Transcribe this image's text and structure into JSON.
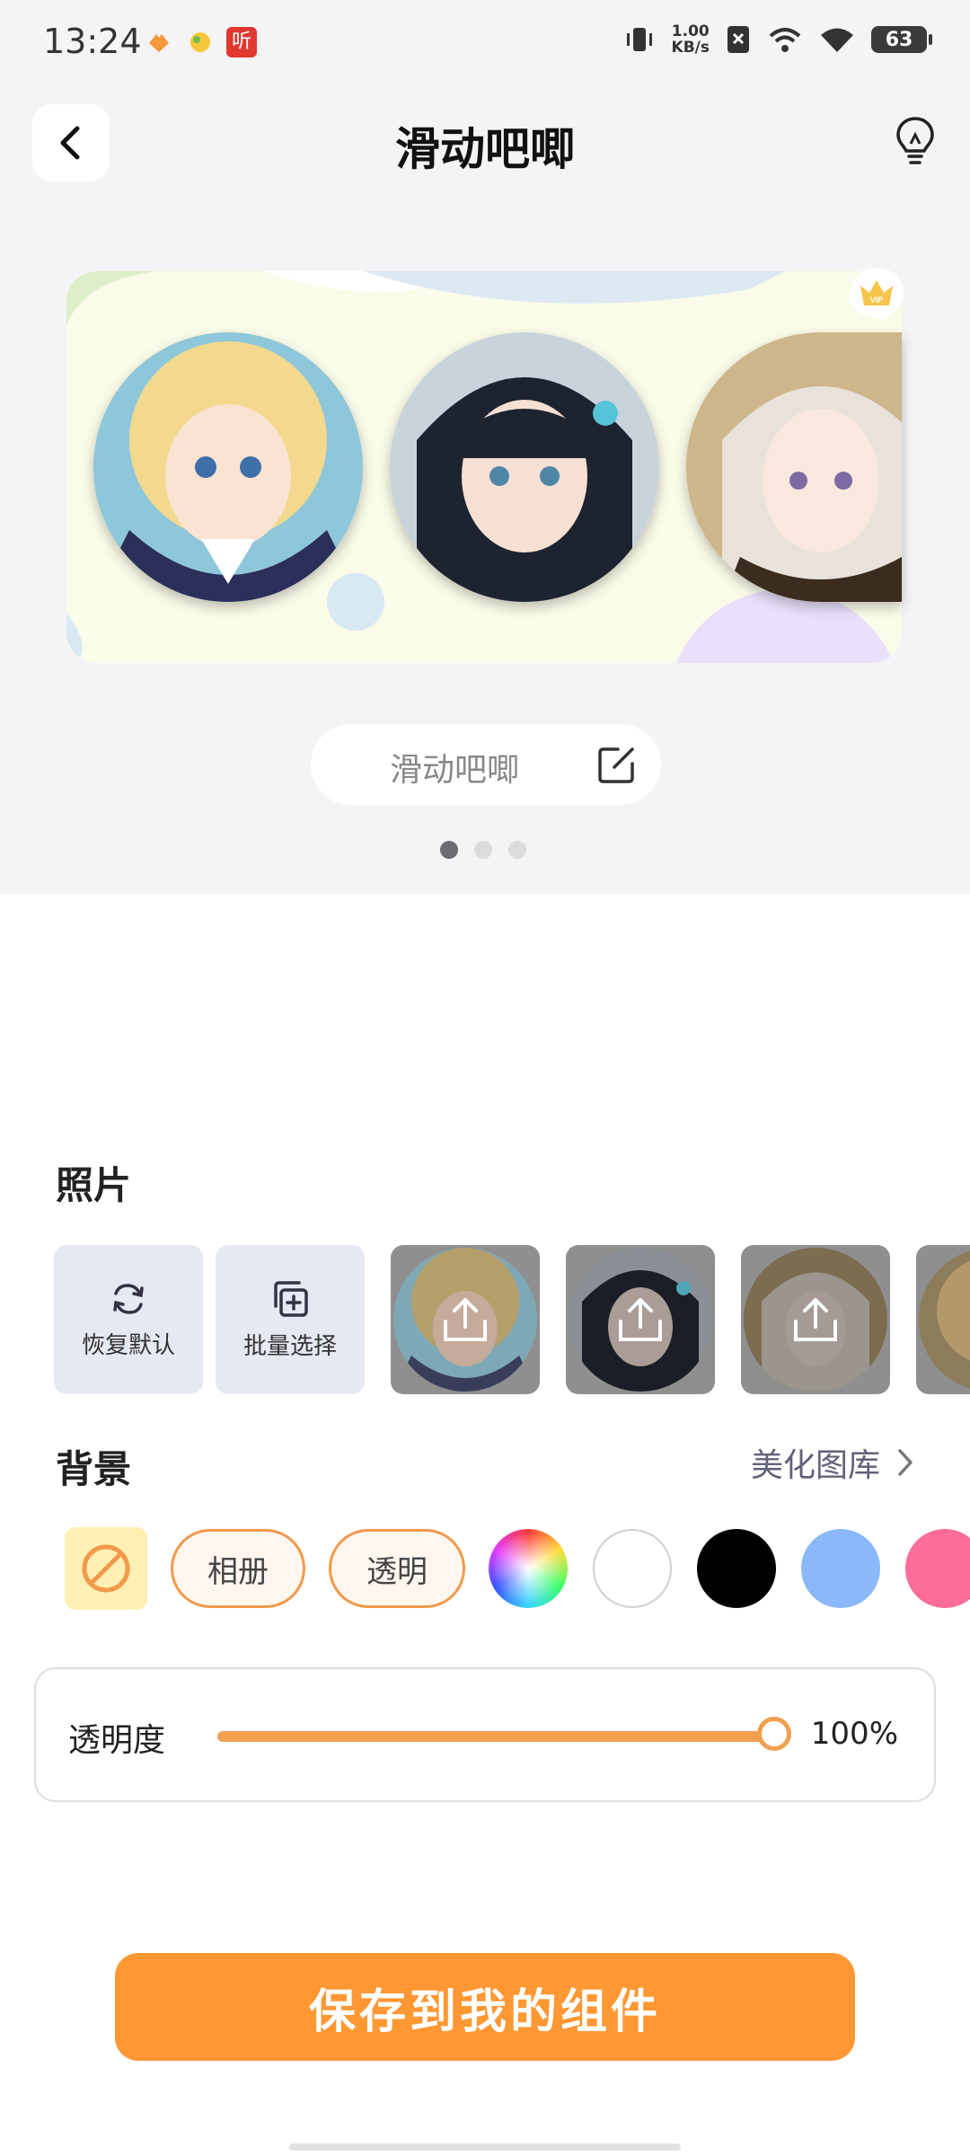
{
  "status_bar": {
    "time": "13:24",
    "net_speed_value": "1.00",
    "net_speed_unit": "KB/s",
    "battery": "63",
    "notif_icons": [
      "heart-app-icon",
      "app-icon",
      "listen-app-icon"
    ],
    "notif_ting": "听"
  },
  "header": {
    "title": "滑动吧唧",
    "back_icon": "chevron-left-icon",
    "hint_icon": "lightbulb-icon"
  },
  "preview": {
    "vip_label": "VIP",
    "widget_name": "滑动吧唧",
    "page_count": 3,
    "active_page": 1
  },
  "photos": {
    "section_title": "照片",
    "reset_label": "恢复默认",
    "batch_label": "批量选择",
    "items": [
      "photo-1",
      "photo-2",
      "photo-3",
      "photo-4"
    ]
  },
  "background": {
    "section_title": "背景",
    "library_link": "美化图库",
    "album_label": "相册",
    "transparent_label": "透明",
    "swatches": [
      "#ffffff",
      "#000000",
      "#8ab8fb",
      "#fc6d97"
    ]
  },
  "opacity": {
    "label": "透明度",
    "value_text": "100%",
    "value_fraction": 1.0
  },
  "save_button_label": "保存到我的组件",
  "colors": {
    "accent": "#ff9733",
    "slider": "#f0a04f"
  }
}
